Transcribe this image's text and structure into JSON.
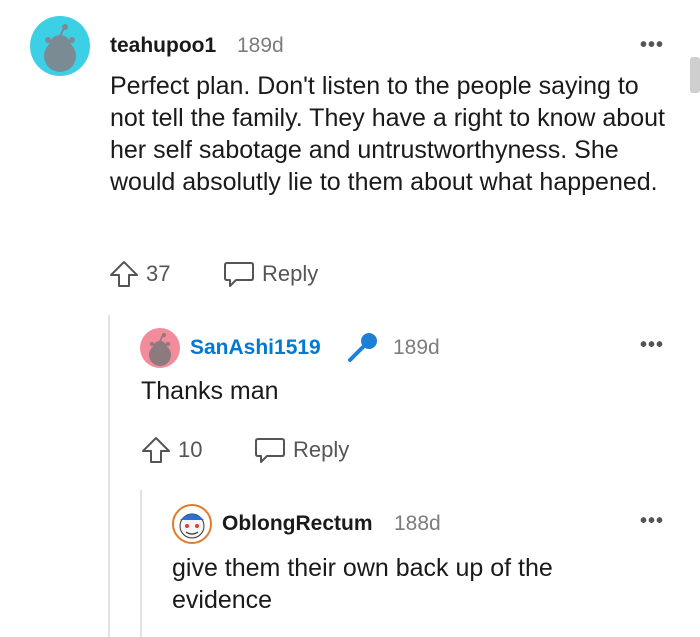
{
  "comments": [
    {
      "username": "teahupoo1",
      "age": "189d",
      "body": "Perfect plan. Don't listen to the people saying to not tell the family. They have a right to know about her self sabotage and untrustworthyness. She would absolutly lie to them about what happened.",
      "votes": "37",
      "reply_label": "Reply",
      "more_label": "•••"
    },
    {
      "username": "SanAshi1519",
      "age": "189d",
      "body": "Thanks man",
      "votes": "10",
      "reply_label": "Reply",
      "more_label": "•••",
      "username_color": "#0079d3"
    },
    {
      "username": "OblongRectum",
      "age": "188d",
      "body": "give them their own back up of the evidence",
      "more_label": "•••"
    }
  ],
  "colors": {
    "avatar1_bg": "#3bd0e6",
    "avatar2_bg": "#f28b9a",
    "mic_icon": "#1e7fd9"
  }
}
